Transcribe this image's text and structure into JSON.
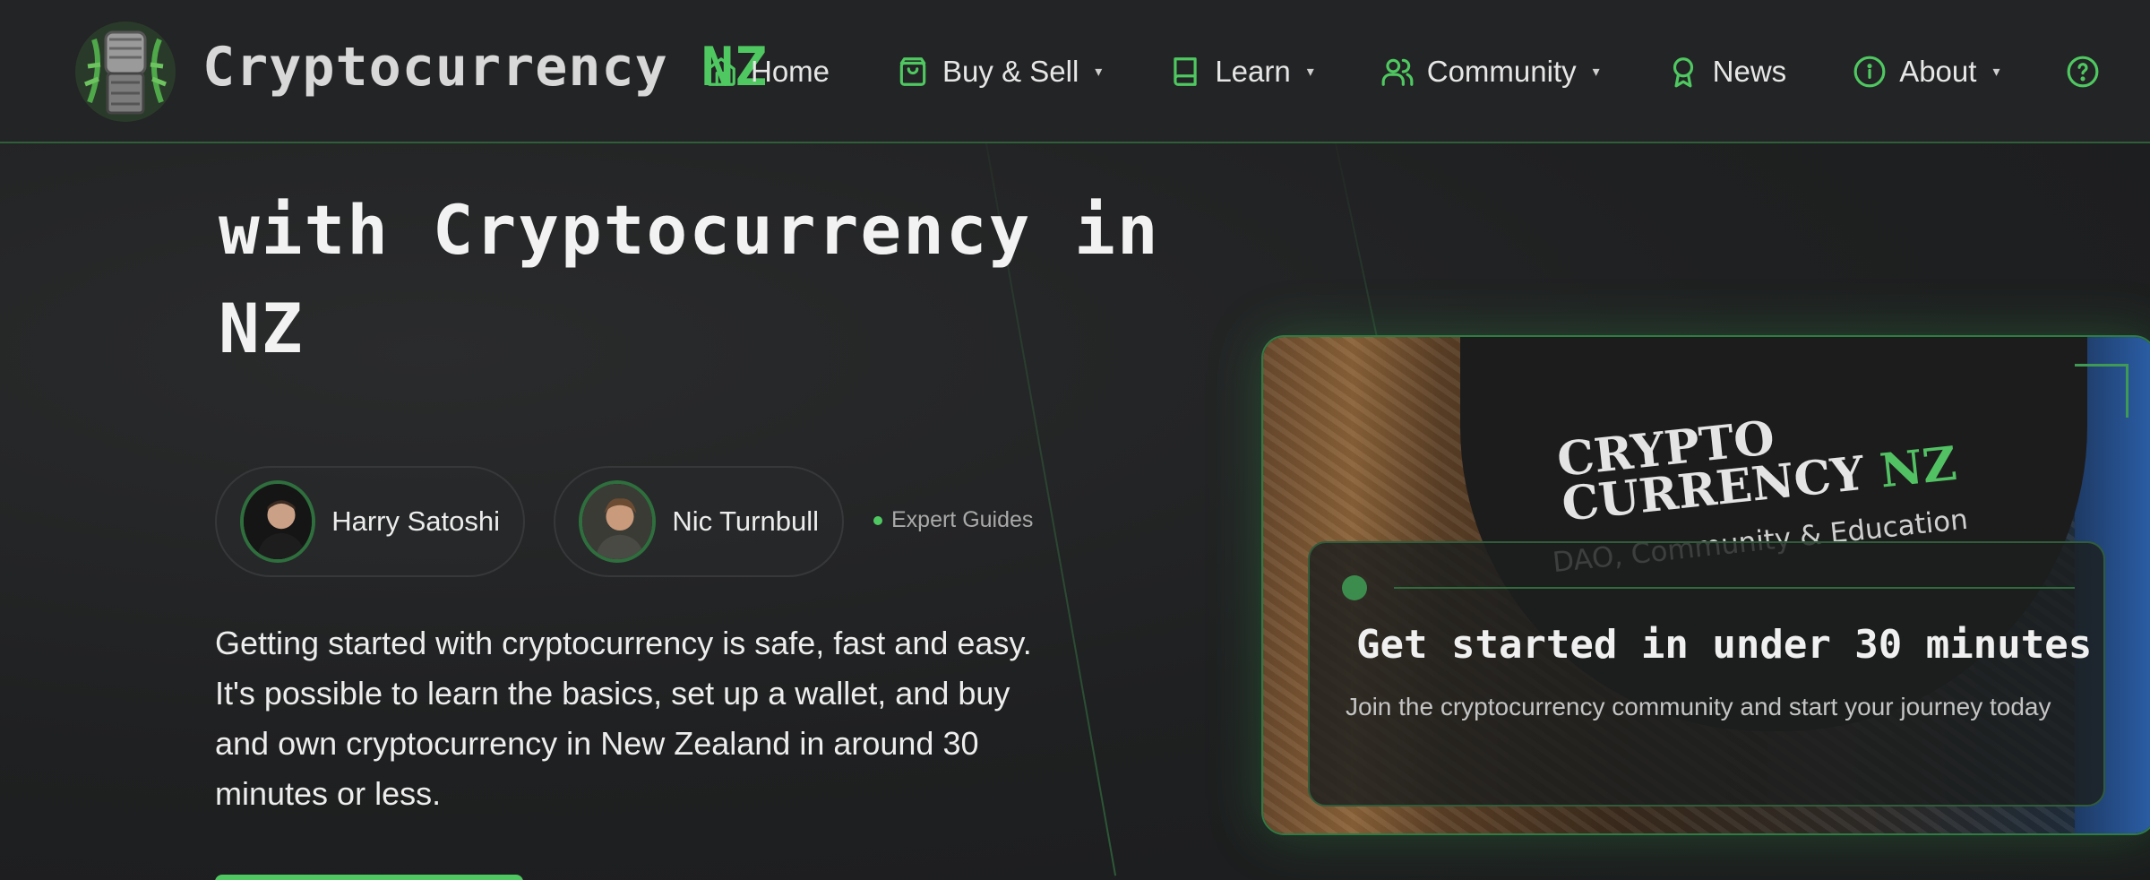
{
  "brand": {
    "name": "Cryptocurrency",
    "suffix": "NZ"
  },
  "nav": {
    "items": [
      {
        "label": "Home",
        "icon": "home-icon",
        "has_caret": false
      },
      {
        "label": "Buy & Sell",
        "icon": "shopping-bag-icon",
        "has_caret": true
      },
      {
        "label": "Learn",
        "icon": "book-icon",
        "has_caret": true
      },
      {
        "label": "Community",
        "icon": "users-icon",
        "has_caret": true
      },
      {
        "label": "News",
        "icon": "award-icon",
        "has_caret": false
      },
      {
        "label": "About",
        "icon": "info-icon",
        "has_caret": true
      }
    ],
    "caret": "▾",
    "help_icon": "help-circle-icon"
  },
  "hero": {
    "heading_line_2": "with Cryptocurrency in",
    "heading_line_3": "NZ",
    "authors": [
      {
        "name": "Harry Satoshi"
      },
      {
        "name": "Nic Turnbull"
      }
    ],
    "expert_label": "Expert Guides",
    "description": "Getting started with cryptocurrency is safe, fast and easy. It's possible to learn the basics, set up a wallet, and buy and own cryptocurrency in New Zealand in around 30 minutes or less."
  },
  "card": {
    "banner_title_line1": "CRYPTO",
    "banner_title_line2": "CURRENCY",
    "banner_title_nz": "NZ",
    "banner_sub": "DAO, Community & Education",
    "overlay_title": "Get started in under 30 minutes",
    "overlay_sub": "Join the cryptocurrency community and start your journey today"
  },
  "colors": {
    "accent": "#4fc861",
    "background": "#1f2021",
    "header": "#232425"
  }
}
